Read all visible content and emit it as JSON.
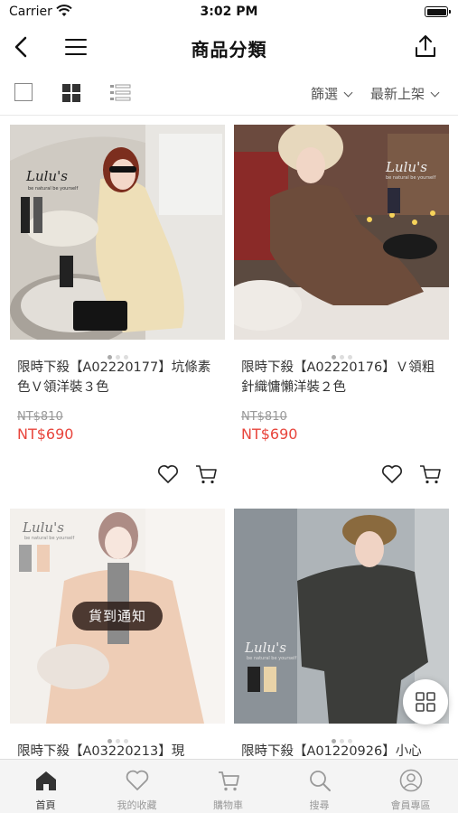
{
  "status_bar": {
    "carrier": "Carrier",
    "time": "3:02 PM"
  },
  "nav": {
    "title": "商品分類",
    "back_icon": "back-arrow-icon",
    "menu_icon": "hamburger-menu-icon",
    "share_icon": "share-icon"
  },
  "toolbar": {
    "view_modes": [
      "single-view-icon",
      "grid-view-icon",
      "list-view-icon"
    ],
    "active_view": "grid",
    "filter_label": "篩選",
    "sort_label": "最新上架"
  },
  "products": [
    {
      "name": "限時下殺【A02220177】坑條素色Ｖ領洋裝３色",
      "old_price": "NT$810",
      "price": "NT$690",
      "brand": "Lulu's",
      "brand_sub": "be natural be yourself",
      "image_dots": 3,
      "active_dot": 0
    },
    {
      "name": "限時下殺【A02220176】Ｖ領粗針織慵懶洋裝２色",
      "old_price": "NT$810",
      "price": "NT$690",
      "brand": "Lulu's",
      "brand_sub": "be natural be yourself",
      "image_dots": 3,
      "active_dot": 0
    },
    {
      "name": "限時下殺【A03220213】現",
      "brand": "Lulu's",
      "brand_sub": "be natural be yourself",
      "notify_label": "貨到通知",
      "image_dots": 3,
      "active_dot": 0
    },
    {
      "name": "限時下殺【A01220926】小心",
      "brand": "Lulu's",
      "brand_sub": "be natural be yourself",
      "image_dots": 3,
      "active_dot": 0
    }
  ],
  "fab_icon": "grid-toggle-icon",
  "tabbar": [
    {
      "label": "首頁",
      "icon": "home-icon",
      "active": true
    },
    {
      "label": "我的收藏",
      "icon": "heart-icon",
      "active": false
    },
    {
      "label": "購物車",
      "icon": "cart-icon",
      "active": false
    },
    {
      "label": "搜尋",
      "icon": "search-icon",
      "active": false
    },
    {
      "label": "會員專區",
      "icon": "user-icon",
      "active": false
    }
  ],
  "colors": {
    "price": "#e8453c",
    "old_price": "#999999",
    "tab_active": "#333333",
    "tab_inactive": "#999999"
  }
}
